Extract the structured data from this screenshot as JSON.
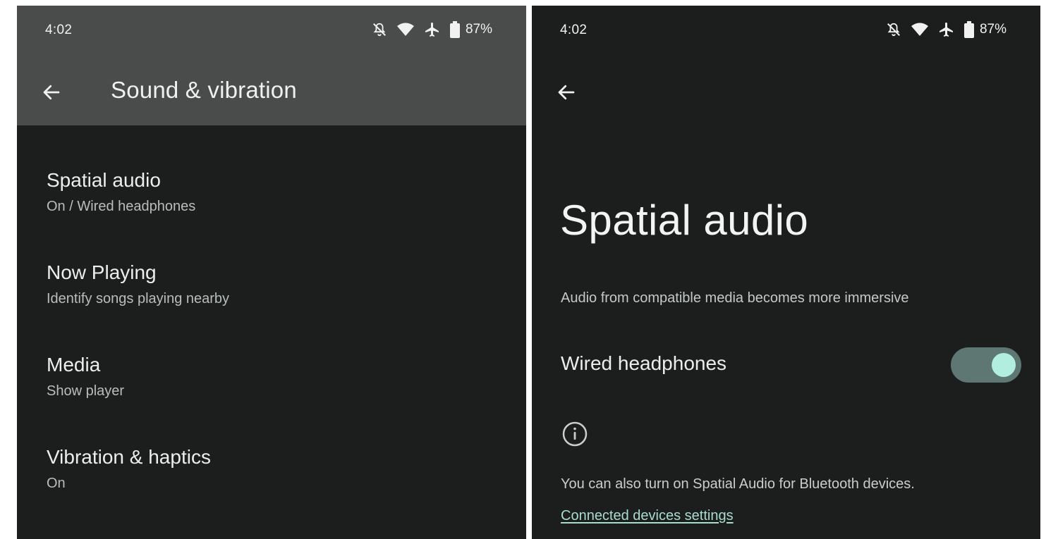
{
  "colors": {
    "surface": "#1c1e1e",
    "app_bar": "#4a4c4c",
    "toggle_track": "#5f7772",
    "toggle_thumb": "#b1eee0",
    "link": "#a8dccf"
  },
  "status_bar": {
    "time": "4:02",
    "icons": [
      "notifications-off-icon",
      "wifi-icon",
      "airplane-icon",
      "battery-icon"
    ],
    "battery": "87%"
  },
  "left_screen": {
    "title": "Sound & vibration",
    "items": [
      {
        "title": "Spatial audio",
        "subtitle": "On / Wired headphones"
      },
      {
        "title": "Now Playing",
        "subtitle": "Identify songs playing nearby"
      },
      {
        "title": "Media",
        "subtitle": "Show player"
      },
      {
        "title": "Vibration & haptics",
        "subtitle": "On"
      }
    ]
  },
  "right_screen": {
    "title": "Spatial audio",
    "description": "Audio from compatible media becomes more immersive",
    "toggle": {
      "label": "Wired headphones",
      "state": "on"
    },
    "footer_text": "You can also turn on Spatial Audio for Bluetooth devices.",
    "link": "Connected devices settings"
  }
}
